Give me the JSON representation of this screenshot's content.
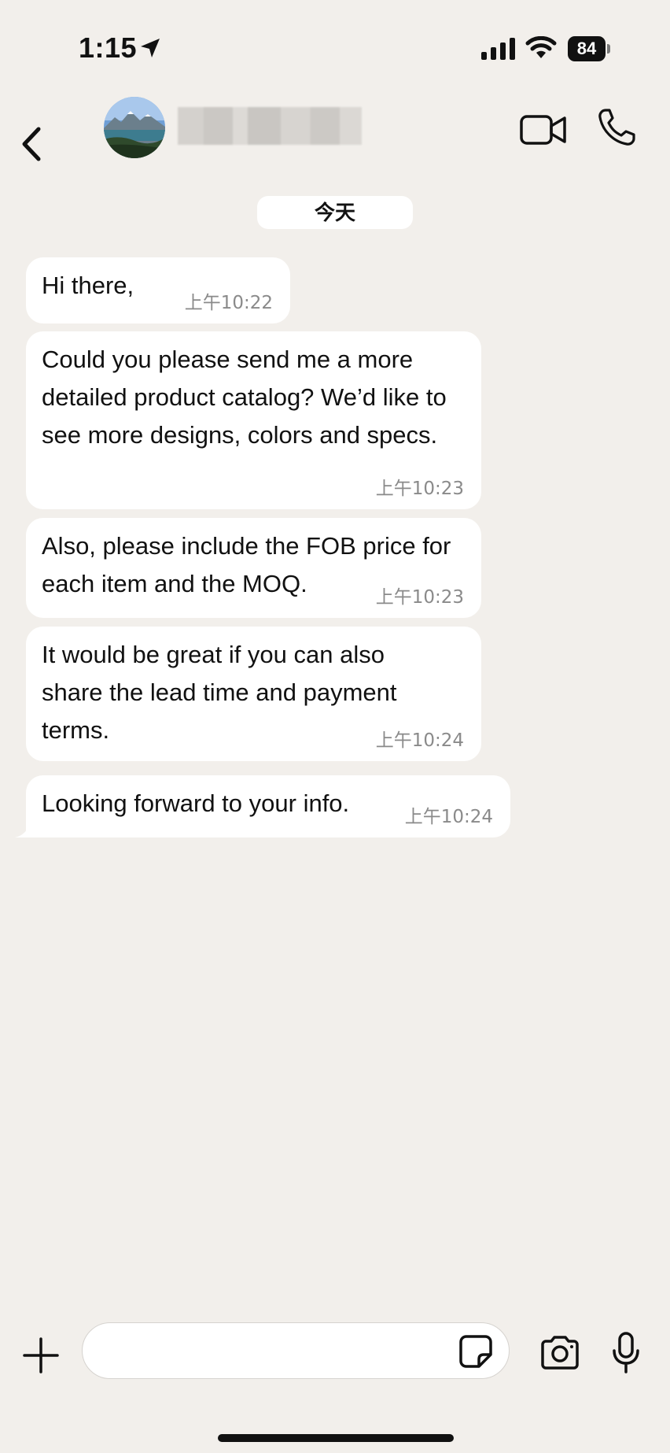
{
  "status_bar": {
    "time": "1:15",
    "battery": "84",
    "icons": [
      "location-arrow-icon",
      "signal-icon",
      "wifi-icon",
      "battery-icon"
    ]
  },
  "header": {
    "back_icon": "chevron-left-icon",
    "contact_name": "",
    "video_call_icon": "video-camera-icon",
    "voice_call_icon": "phone-icon"
  },
  "chat": {
    "date_label": "今天",
    "messages": [
      {
        "text": "Hi there,",
        "time": "上午10:22"
      },
      {
        "text": "Could you please send me a more detailed product catalog? We’d like to see more designs, colors and specs.",
        "time": "上午10:23"
      },
      {
        "text": "Also, please include the FOB price for each item and the MOQ.",
        "time": "上午10:23"
      },
      {
        "text": "It would be great if you can also share the lead time and payment terms.",
        "time": "上午10:24"
      },
      {
        "text": "Looking forward to your info.",
        "time": "上午10:24"
      }
    ]
  },
  "composer": {
    "input_value": "",
    "input_placeholder": "",
    "icons": [
      "plus-icon",
      "sticker-icon",
      "camera-icon",
      "microphone-icon"
    ]
  },
  "colors": {
    "background": "#f2efeb",
    "bubble": "#ffffff",
    "timestamp": "#8a8a8a",
    "text": "#111111"
  }
}
